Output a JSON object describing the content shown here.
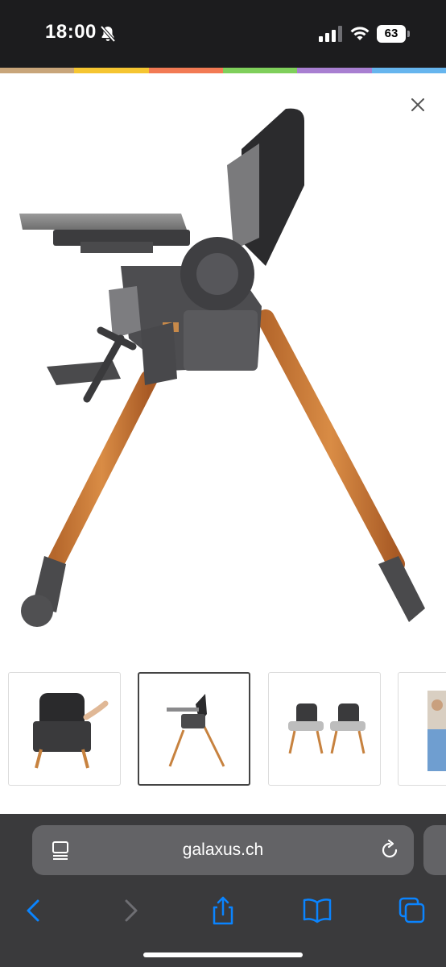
{
  "status_bar": {
    "time": "18:00",
    "battery_level": "63",
    "icons": [
      "bell-slash-icon",
      "signal-icon",
      "wifi-icon",
      "battery-icon"
    ]
  },
  "brand_stripe": [
    "#c8a57a",
    "#f5c531",
    "#f27a54",
    "#7fcf5b",
    "#a87fd1",
    "#66b5ee"
  ],
  "product_viewer": {
    "close_icon": "close-icon",
    "main_image": "high-chair-side-view",
    "thumbnails": [
      {
        "image": "high-chair-back-view",
        "selected": false
      },
      {
        "image": "high-chair-side-view",
        "selected": true
      },
      {
        "image": "two-high-chairs-with-trays",
        "selected": false
      },
      {
        "image": "lifestyle-photo",
        "selected": false
      }
    ]
  },
  "browser": {
    "url": "galaxus.ch",
    "icons": {
      "reader": "reader-mode-icon",
      "reload": "reload-icon",
      "back": "back-chevron-icon",
      "forward": "forward-chevron-icon",
      "share": "share-icon",
      "bookmarks": "book-icon",
      "tabs": "tabs-icon"
    },
    "accent": "#0a84ff"
  }
}
